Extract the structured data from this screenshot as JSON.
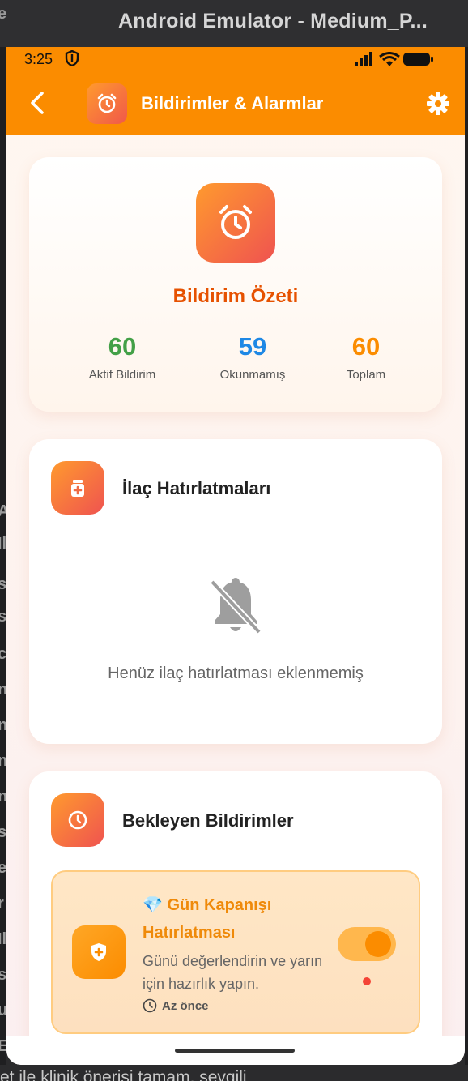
{
  "host": {
    "window_title": "Android Emulator - Medium_P...",
    "left_fragments": [
      "e",
      "Al",
      "Il",
      "s",
      "s",
      "c",
      "nc",
      "nc",
      "na",
      "na",
      "s",
      "e",
      "r",
      "Il",
      "s",
      "u",
      "E"
    ],
    "bottom_text": "et ile klinik önerisi tamam, sevgili"
  },
  "status_bar": {
    "time": "3:25"
  },
  "app_bar": {
    "title": "Bildirimler & Alarmlar",
    "back_icon": "arrow-back-icon",
    "settings_icon": "gear-icon",
    "accent": "#fb8c00"
  },
  "summary": {
    "title": "Bildirim Özeti",
    "stats": [
      {
        "value": "60",
        "label": "Aktif Bildirim",
        "color": "#43a047"
      },
      {
        "value": "59",
        "label": "Okunmamış",
        "color": "#1e88e5"
      },
      {
        "value": "60",
        "label": "Toplam",
        "color": "#fb8c00"
      }
    ]
  },
  "medications": {
    "title": "İlaç Hatırlatmaları",
    "empty_text": "Henüz ilaç hatırlatması eklenmemiş"
  },
  "pending": {
    "title": "Bekleyen Bildirimler",
    "items": [
      {
        "title": "💎 Gün Kapanışı Hatırlatması",
        "body": "Günü değerlendirin ve yarın için hazırlık yapın.",
        "time": "Az önce",
        "enabled": true
      }
    ]
  }
}
